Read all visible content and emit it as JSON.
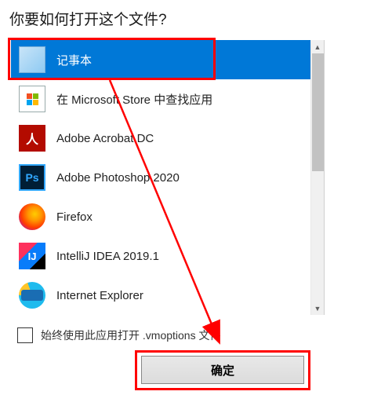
{
  "title": "你要如何打开这个文件?",
  "apps": [
    {
      "label": "记事本",
      "icon": "notepad-icon",
      "selected": true
    },
    {
      "label": "在 Microsoft Store 中查找应用",
      "icon": "store-icon",
      "selected": false
    },
    {
      "label": "Adobe Acrobat DC",
      "icon": "acrobat-icon",
      "selected": false
    },
    {
      "label": "Adobe Photoshop 2020",
      "icon": "photoshop-icon",
      "selected": false
    },
    {
      "label": "Firefox",
      "icon": "firefox-icon",
      "selected": false
    },
    {
      "label": "IntelliJ IDEA 2019.1",
      "icon": "intellij-icon",
      "selected": false
    },
    {
      "label": "Internet Explorer",
      "icon": "ie-icon",
      "selected": false
    }
  ],
  "checkbox_label": "始终使用此应用打开 .vmoptions 文件",
  "checkbox_checked": false,
  "ok_button": "确定",
  "annotation": {
    "highlight_selected": true,
    "highlight_ok": true,
    "arrow_color": "#FF0000"
  }
}
